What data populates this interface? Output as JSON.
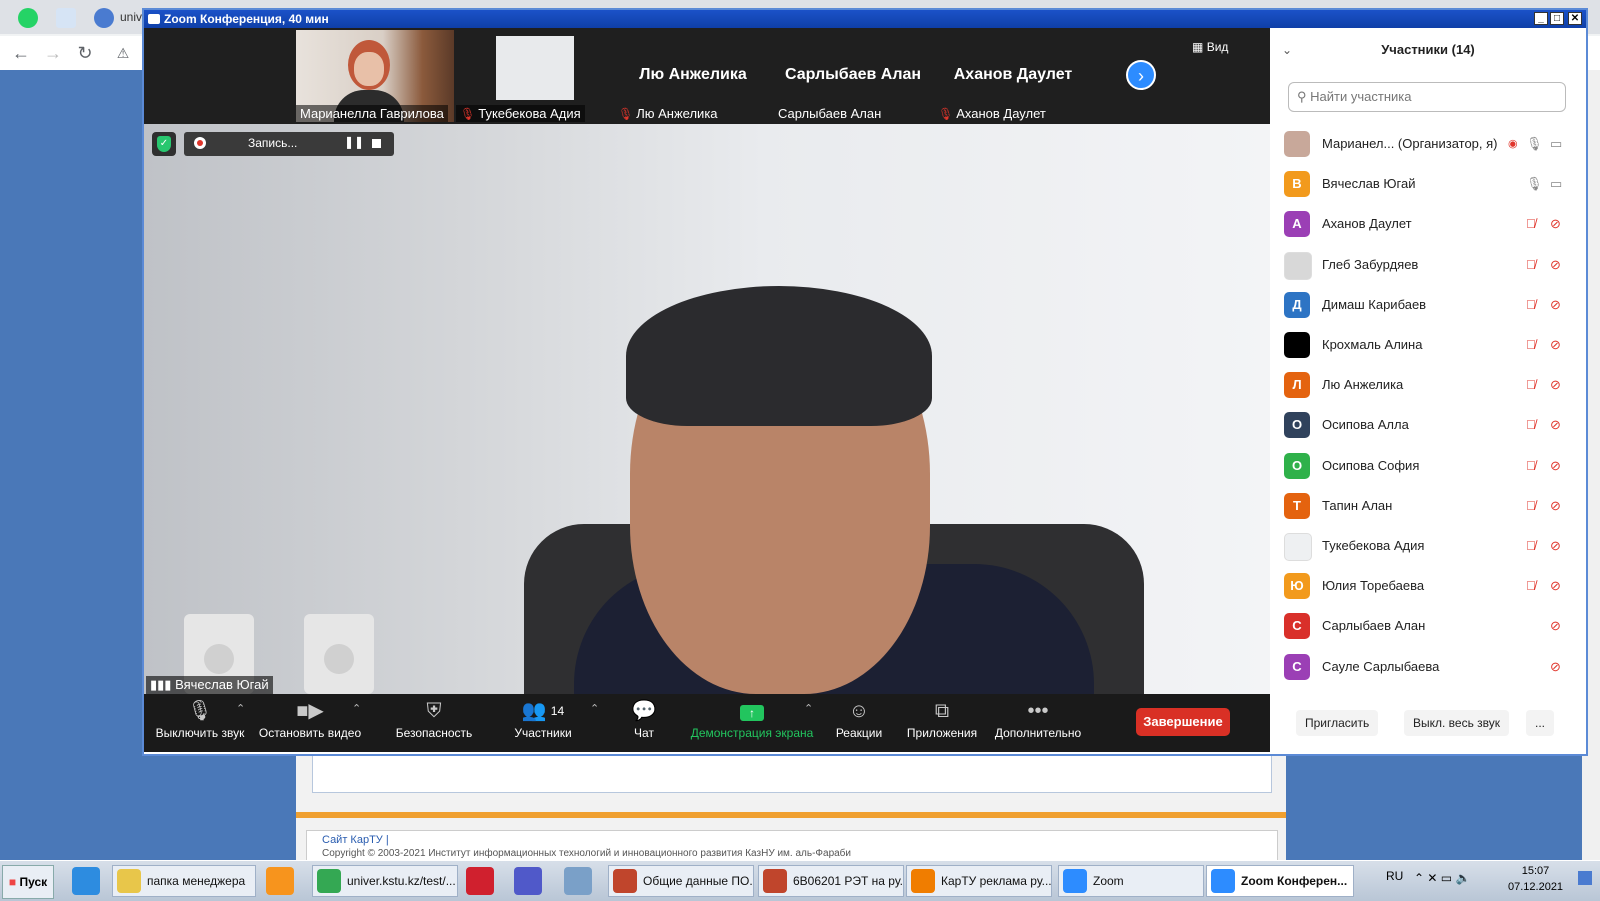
{
  "browser": {
    "tab_text": "univ"
  },
  "background_page": {
    "footer_link": "Сайт КарТУ |",
    "footer_copy": "Copyright © 2003-2021 Институт информационных технологий и инновационного развития КазНУ им. аль-Фараби"
  },
  "zoom": {
    "title": "Zoom Конференция, 40 мин",
    "view_label": "Вид",
    "gallery": [
      {
        "big": "",
        "name": "Марианелла Гаврилова",
        "muted": false
      },
      {
        "big": "",
        "name": "Тукебекова Адия",
        "muted": true
      },
      {
        "big": "Лю Анжелика",
        "name": "Лю Анжелика",
        "muted": true
      },
      {
        "big": "Сарлыбаев Алан",
        "name": "Сарлыбаев Алан",
        "muted": false
      },
      {
        "big": "Аханов Даулет",
        "name": "Аханов Даулет",
        "muted": true
      }
    ],
    "recording_label": "Запись...",
    "speaker_name": "Вячеслав Югай",
    "toolbar": {
      "mute": "Выключить звук",
      "stop_video": "Остановить видео",
      "security": "Безопасность",
      "participants": "Участники",
      "participants_count": "14",
      "chat": "Чат",
      "share": "Демонстрация экрана",
      "reactions": "Реакции",
      "apps": "Приложения",
      "more": "Дополнительно",
      "end": "Завершение"
    },
    "panel": {
      "title": "Участники (14)",
      "search_placeholder": "Найти участника",
      "participants": [
        {
          "initial": "",
          "name": "Марианел...  (Организатор, я)",
          "color": "#c8a89a"
        },
        {
          "initial": "В",
          "name": "Вячеслав Югай",
          "color": "#f29a1d"
        },
        {
          "initial": "А",
          "name": "Аханов Даулет",
          "color": "#9b3fb5"
        },
        {
          "initial": "",
          "name": "Глеб Забурдяев",
          "color": "#d8d8d8"
        },
        {
          "initial": "Д",
          "name": "Димаш Карибаев",
          "color": "#2d74c4"
        },
        {
          "initial": "",
          "name": "Крохмаль Алина",
          "color": "#000000"
        },
        {
          "initial": "Л",
          "name": "Лю Анжелика",
          "color": "#e4630f"
        },
        {
          "initial": "О",
          "name": "Осипова Алла",
          "color": "#30425c"
        },
        {
          "initial": "О",
          "name": "Осипова София",
          "color": "#2fb14a"
        },
        {
          "initial": "Т",
          "name": "Тапин Алан",
          "color": "#e4630f"
        },
        {
          "initial": "",
          "name": "Тукебекова Адия",
          "color": "#eef0f2"
        },
        {
          "initial": "Ю",
          "name": "Юлия Торебаева",
          "color": "#f29a1d"
        },
        {
          "initial": "С",
          "name": "Сарлыбаев Алан",
          "color": "#d9302a"
        },
        {
          "initial": "С",
          "name": "Сауле Сарлыбаева",
          "color": "#9b3fb5"
        }
      ],
      "invite": "Пригласить",
      "mute_all": "Выкл. весь звук",
      "more": "..."
    }
  },
  "taskbar": {
    "start": "Пуск",
    "items": [
      {
        "label": "папка менеджера",
        "active": false
      },
      {
        "label": "univer.kstu.kz/test/...",
        "active": false
      },
      {
        "label": "Общие данные ПО...",
        "active": false
      },
      {
        "label": "6B06201 РЭТ на ру...",
        "active": false
      },
      {
        "label": "КарТУ реклама ру...",
        "active": false
      },
      {
        "label": "Zoom",
        "active": false
      },
      {
        "label": "Zoom Конферен...",
        "active": true
      }
    ],
    "lang": "RU",
    "time": "15:07",
    "date": "07.12.2021"
  }
}
